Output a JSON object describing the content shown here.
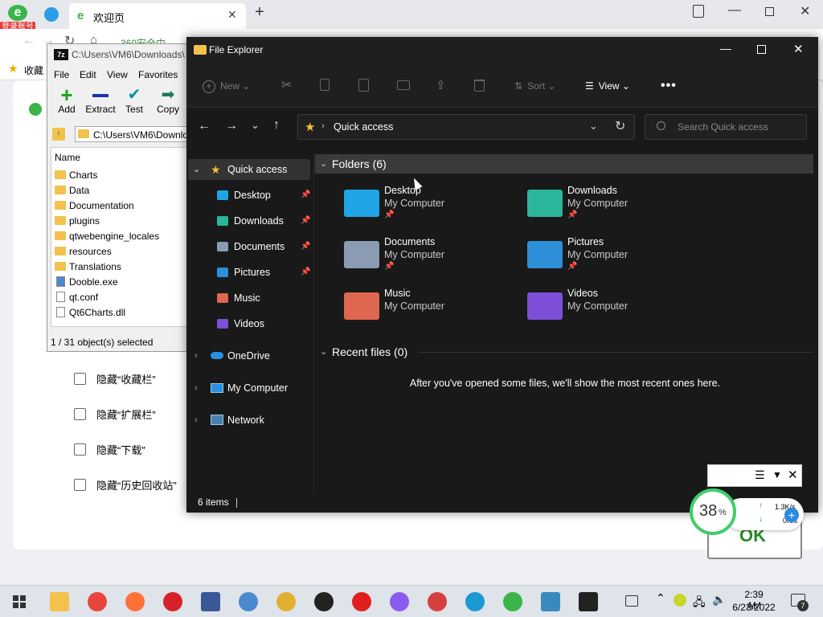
{
  "browser": {
    "tab_title": "欢迎页",
    "login_badge": "登录账号",
    "address_partial": "360安全中...",
    "bookmarks_label": "收藏",
    "checkbox_options": [
      "隐藏“收藏栏”",
      "隐藏“扩展栏”",
      "隐藏“下载”",
      "隐藏“历史回收站”"
    ]
  },
  "sevenzip": {
    "title": "C:\\Users\\VM6\\Downloads\\",
    "menu": [
      "File",
      "Edit",
      "View",
      "Favorites"
    ],
    "toolbar": [
      "Add",
      "Extract",
      "Test",
      "Copy"
    ],
    "path": "C:\\Users\\VM6\\Downlo",
    "column_name": "Name",
    "files": [
      {
        "name": "Charts",
        "type": "folder"
      },
      {
        "name": "Data",
        "type": "folder"
      },
      {
        "name": "Documentation",
        "type": "folder"
      },
      {
        "name": "plugins",
        "type": "folder"
      },
      {
        "name": "qtwebengine_locales",
        "type": "folder"
      },
      {
        "name": "resources",
        "type": "folder"
      },
      {
        "name": "Translations",
        "type": "folder"
      },
      {
        "name": "Dooble.exe",
        "type": "exe"
      },
      {
        "name": "qt.conf",
        "type": "file"
      },
      {
        "name": "Qt6Charts.dll",
        "type": "file"
      }
    ],
    "status": "1 / 31 object(s) selected"
  },
  "explorer": {
    "title": "File Explorer",
    "toolbar": {
      "new": "New",
      "sort": "Sort",
      "view": "View"
    },
    "address": "Quick access",
    "search_placeholder": "Search Quick access",
    "nav": {
      "quick_access": "Quick access",
      "pinned": [
        "Desktop",
        "Downloads",
        "Documents",
        "Pictures"
      ],
      "unpinned": [
        "Music",
        "Videos"
      ],
      "onedrive": "OneDrive",
      "my_computer": "My Computer",
      "network": "Network"
    },
    "folders_header": "Folders (6)",
    "folders": [
      {
        "name": "Desktop",
        "location": "My Computer",
        "pinned": true,
        "color": "#1fa5e6"
      },
      {
        "name": "Downloads",
        "location": "My Computer",
        "pinned": true,
        "color": "#2bb59a"
      },
      {
        "name": "Documents",
        "location": "My Computer",
        "pinned": true,
        "color": "#8a9bb3"
      },
      {
        "name": "Pictures",
        "location": "My Computer",
        "pinned": true,
        "color": "#2d8fd8"
      },
      {
        "name": "Music",
        "location": "My Computer",
        "pinned": false,
        "color": "#e0674f"
      },
      {
        "name": "Videos",
        "location": "My Computer",
        "pinned": false,
        "color": "#7d4ed6"
      }
    ],
    "recent_header": "Recent files (0)",
    "recent_empty": "After you've opened some files, we'll show the most recent ones here.",
    "status": "6 items"
  },
  "widget": {
    "percent": "38",
    "percent_sign": "%",
    "up": "1.3K/s",
    "down": "0K/s",
    "ok": "OK"
  },
  "taskbar": {
    "time": "2:39 AM",
    "date": "6/23/2022",
    "notification_count": "7",
    "apps": [
      "file-explorer",
      "chrome",
      "firefox",
      "opera",
      "facebook",
      "chromium",
      "yandex-browser-alt",
      "opera-gx",
      "yandex",
      "navi",
      "browser-ie-alt",
      "maxthon",
      "360-browser",
      "remote-desktop",
      "7zip"
    ]
  }
}
